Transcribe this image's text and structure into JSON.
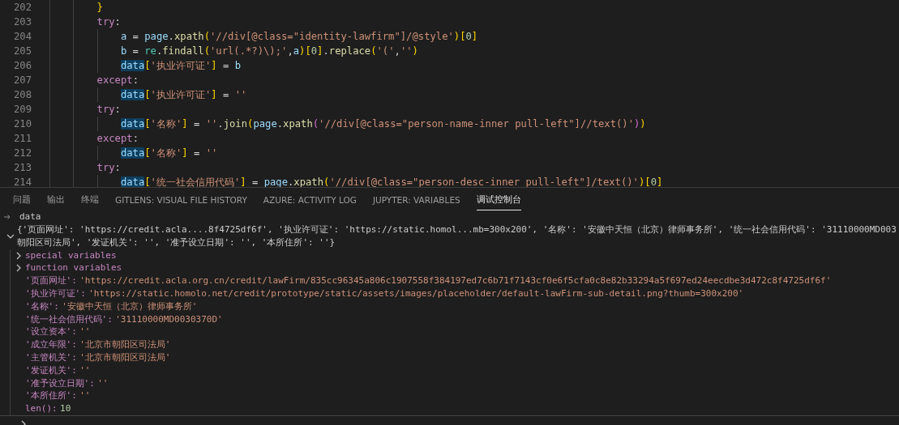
{
  "editor": {
    "lines": [
      {
        "number": "202",
        "tokens": [
          {
            "text": "}",
            "kind": "bracket1"
          }
        ]
      },
      {
        "number": "203",
        "tokens": [
          {
            "text": "try",
            "kind": "keyword"
          },
          {
            "text": ":",
            "kind": "punct"
          }
        ],
        "children": [
          {
            "number": "204",
            "tokens": [
              {
                "text": "a",
                "kind": "variable"
              },
              {
                "text": " = ",
                "kind": "punct"
              },
              {
                "text": "page",
                "kind": "variable"
              },
              {
                "text": ".",
                "kind": "punct"
              },
              {
                "text": "xpath",
                "kind": "function"
              },
              {
                "text": "(",
                "kind": "bracket1"
              },
              {
                "text": "'//div[@class=\"identity-lawfirm\"]/@style'",
                "kind": "string"
              },
              {
                "text": ")",
                "kind": "bracket1"
              },
              {
                "text": "[",
                "kind": "bracket1"
              },
              {
                "text": "0",
                "kind": "number"
              },
              {
                "text": "]",
                "kind": "bracket1"
              }
            ]
          },
          {
            "number": "205",
            "tokens": [
              {
                "text": "b",
                "kind": "variable"
              },
              {
                "text": " = ",
                "kind": "punct"
              },
              {
                "text": "re",
                "kind": "class"
              },
              {
                "text": ".",
                "kind": "punct"
              },
              {
                "text": "findall",
                "kind": "function"
              },
              {
                "text": "(",
                "kind": "bracket1"
              },
              {
                "text": "'url(.*?)\\);'",
                "kind": "string"
              },
              {
                "text": ",",
                "kind": "punct"
              },
              {
                "text": "a",
                "kind": "variable"
              },
              {
                "text": ")",
                "kind": "bracket1"
              },
              {
                "text": "[",
                "kind": "bracket1"
              },
              {
                "text": "0",
                "kind": "number"
              },
              {
                "text": "]",
                "kind": "bracket1"
              },
              {
                "text": ".",
                "kind": "punct"
              },
              {
                "text": "replace",
                "kind": "function"
              },
              {
                "text": "(",
                "kind": "bracket1"
              },
              {
                "text": "'('",
                "kind": "string"
              },
              {
                "text": ",",
                "kind": "punct"
              },
              {
                "text": "''",
                "kind": "string"
              },
              {
                "text": ")",
                "kind": "bracket1"
              }
            ]
          },
          {
            "number": "206",
            "tokens": [
              {
                "text": "data",
                "kind": "highlight"
              },
              {
                "text": "[",
                "kind": "bracket1"
              },
              {
                "text": "'执业许可证'",
                "kind": "string"
              },
              {
                "text": "]",
                "kind": "bracket1"
              },
              {
                "text": " = ",
                "kind": "punct"
              },
              {
                "text": "b",
                "kind": "variable"
              }
            ]
          }
        ]
      },
      {
        "number": "207",
        "tokens": [
          {
            "text": "except",
            "kind": "keyword"
          },
          {
            "text": ":",
            "kind": "punct"
          }
        ],
        "children": [
          {
            "number": "208",
            "tokens": [
              {
                "text": "data",
                "kind": "highlight"
              },
              {
                "text": "[",
                "kind": "bracket1"
              },
              {
                "text": "'执业许可证'",
                "kind": "string"
              },
              {
                "text": "]",
                "kind": "bracket1"
              },
              {
                "text": " = ",
                "kind": "punct"
              },
              {
                "text": "''",
                "kind": "string"
              }
            ]
          }
        ]
      },
      {
        "number": "209",
        "tokens": [
          {
            "text": "try",
            "kind": "keyword"
          },
          {
            "text": ":",
            "kind": "punct"
          }
        ],
        "children": [
          {
            "number": "210",
            "tokens": [
              {
                "text": "data",
                "kind": "highlight"
              },
              {
                "text": "[",
                "kind": "bracket1"
              },
              {
                "text": "'名称'",
                "kind": "string"
              },
              {
                "text": "]",
                "kind": "bracket1"
              },
              {
                "text": " = ",
                "kind": "punct"
              },
              {
                "text": "''",
                "kind": "string"
              },
              {
                "text": ".",
                "kind": "punct"
              },
              {
                "text": "join",
                "kind": "function"
              },
              {
                "text": "(",
                "kind": "bracket1"
              },
              {
                "text": "page",
                "kind": "variable"
              },
              {
                "text": ".",
                "kind": "punct"
              },
              {
                "text": "xpath",
                "kind": "function"
              },
              {
                "text": "(",
                "kind": "bracket2"
              },
              {
                "text": "'//div[@class=\"person-name-inner pull-left\"]//text()'",
                "kind": "string"
              },
              {
                "text": ")",
                "kind": "bracket2"
              },
              {
                "text": ")",
                "kind": "bracket1"
              }
            ]
          }
        ]
      },
      {
        "number": "211",
        "tokens": [
          {
            "text": "except",
            "kind": "keyword"
          },
          {
            "text": ":",
            "kind": "punct"
          }
        ],
        "children": [
          {
            "number": "212",
            "tokens": [
              {
                "text": "data",
                "kind": "highlight"
              },
              {
                "text": "[",
                "kind": "bracket1"
              },
              {
                "text": "'名称'",
                "kind": "string"
              },
              {
                "text": "]",
                "kind": "bracket1"
              },
              {
                "text": " = ",
                "kind": "punct"
              },
              {
                "text": "''",
                "kind": "string"
              }
            ]
          }
        ]
      },
      {
        "number": "213",
        "tokens": [
          {
            "text": "try",
            "kind": "keyword"
          },
          {
            "text": ":",
            "kind": "punct"
          }
        ],
        "children": [
          {
            "number": "214",
            "tokens": [
              {
                "text": "data",
                "kind": "highlight"
              },
              {
                "text": "[",
                "kind": "bracket1"
              },
              {
                "text": "'统一社会信用代码'",
                "kind": "string"
              },
              {
                "text": "]",
                "kind": "bracket1"
              },
              {
                "text": " = ",
                "kind": "punct"
              },
              {
                "text": "page",
                "kind": "variable"
              },
              {
                "text": ".",
                "kind": "punct"
              },
              {
                "text": "xpath",
                "kind": "function"
              },
              {
                "text": "(",
                "kind": "bracket1"
              },
              {
                "text": "'//div[@class=\"person-desc-inner pull-left\"]/text()'",
                "kind": "string"
              },
              {
                "text": ")",
                "kind": "bracket1"
              },
              {
                "text": "[",
                "kind": "bracket1"
              },
              {
                "text": "0",
                "kind": "number"
              },
              {
                "text": "]",
                "kind": "bracket1"
              }
            ]
          }
        ]
      }
    ]
  },
  "panel": {
    "tabs": [
      {
        "label": "问题",
        "selected": false
      },
      {
        "label": "输出",
        "selected": false
      },
      {
        "label": "终端",
        "selected": false
      },
      {
        "label": "GITLENS: VISUAL FILE HISTORY",
        "selected": false
      },
      {
        "label": "AZURE: ACTIVITY LOG",
        "selected": false
      },
      {
        "label": "JUPYTER: VARIABLES",
        "selected": false
      },
      {
        "label": "调试控制台",
        "selected": true
      }
    ],
    "console": {
      "entries": [
        {
          "kind": "input",
          "text": "data"
        },
        {
          "kind": "object",
          "expanded": true,
          "summary_lines": [
            "{'页面网址': 'https://credit.acla....8f4725df6f', '执业许可证': 'https://static.homol...mb=300x200', '名称': '安徽中天恒（北京）律师事务所', '统一社会信用代码': '31110000MD003",
            "朝阳区司法局', '发证机关': '', '准予设立日期': '', '本所住所': ''}"
          ],
          "children": [
            {
              "kind": "group",
              "label": "special variables",
              "expanded": false
            },
            {
              "kind": "group",
              "label": "function variables",
              "expanded": false
            },
            {
              "kind": "property",
              "key": "'页面网址':",
              "value": "'https://credit.acla.org.cn/credit/lawFirm/835cc96345a806c1907558f384197ed7c6b71f7143cf0e6f5cfa0c8e82b33294a5f697ed24eecdbe3d472c8f4725df6f'"
            },
            {
              "kind": "property",
              "key": "'执业许可证':",
              "value": "'https://static.homolo.net/credit/prototype/static/assets/images/placeholder/default-lawFirm-sub-detail.png?thumb=300x200'"
            },
            {
              "kind": "property",
              "key": "'名称':",
              "value": "'安徽中天恒（北京）律师事务所'"
            },
            {
              "kind": "property",
              "key": "'统一社会信用代码':",
              "value": "'31110000MD0030370D'"
            },
            {
              "kind": "property",
              "key": "'设立资本':",
              "value": "''"
            },
            {
              "kind": "property",
              "key": "'成立年限':",
              "value": "'北京市朝阳区司法局'"
            },
            {
              "kind": "property",
              "key": "'主管机关':",
              "value": "'北京市朝阳区司法局'"
            },
            {
              "kind": "property",
              "key": "'发证机关':",
              "value": "''"
            },
            {
              "kind": "property",
              "key": "'准予设立日期':",
              "value": "''"
            },
            {
              "kind": "property",
              "key": "'本所住所':",
              "value": "''"
            },
            {
              "kind": "length",
              "key": "len():",
              "value": "10"
            }
          ]
        }
      ]
    }
  }
}
